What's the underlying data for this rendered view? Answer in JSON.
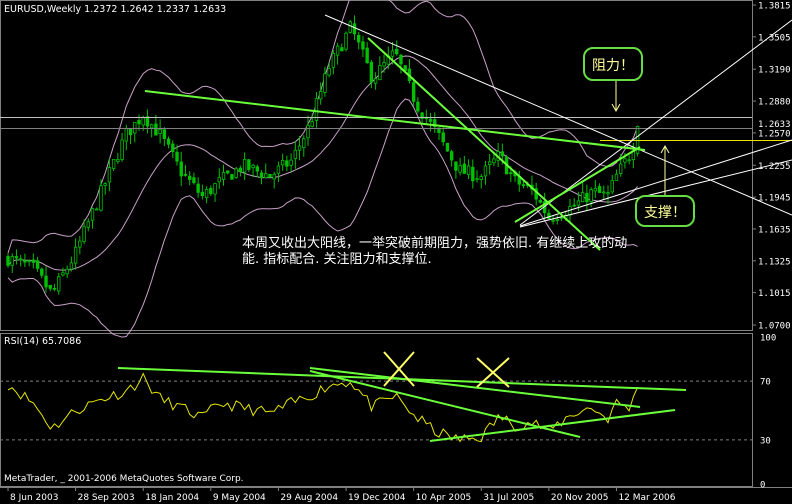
{
  "main_header": "EURUSD,Weekly  1.2372 1.2642 1.2337 1.2633",
  "rsi_header": "RSI(14) 65.7086",
  "copyright": "MetaTrader, _ 2001-2006 MetaQuotes Software Corp.",
  "annotation_line1": "本周又收出大阳线，一举突破前期阻力，强势依旧. 有继续上攻的动",
  "annotation_line2": "能. 指标配合. 关注阻力和支撑位.",
  "resistance_label": "阻力！",
  "support_label": "支撑！",
  "current_price_label": "1.2633",
  "price_ticks": [
    "1.3815",
    "1.3505",
    "1.3190",
    "1.2880",
    "1.2570",
    "1.2255",
    "1.1945",
    "1.1635",
    "1.1325",
    "1.1015",
    "1.0700"
  ],
  "rsi_ticks": [
    "100",
    "70",
    "30",
    "0"
  ],
  "date_ticks": [
    "8 Jun 2003",
    "28 Sep 2003",
    "18 Jan 2004",
    "9 May 2004",
    "29 Aug 2004",
    "19 Dec 2004",
    "10 Apr 2005",
    "31 Jul 2005",
    "20 Nov 2005",
    "12 Mar 2006"
  ],
  "colors": {
    "background": "#000000",
    "candles": "#00c000",
    "bands": "#c8a0c8",
    "trendlines": "#6aff3a",
    "rsi_line": "#e6e600",
    "cross_marks": "#ffff66",
    "callout_border": "#66dd44",
    "callout_text": "#ffff99",
    "grid": "#808080"
  },
  "chart_data": [
    {
      "type": "candlestick",
      "title": "EURUSD,Weekly  1.2372 1.2642 1.2337 1.2633",
      "ylim": [
        1.07,
        1.3815
      ],
      "y_ticks": [
        1.3815,
        1.3505,
        1.319,
        1.288,
        1.257,
        1.2255,
        1.1945,
        1.1635,
        1.1325,
        1.1015,
        1.07
      ],
      "x_ticks": [
        "8 Jun 2003",
        "28 Sep 2003",
        "18 Jan 2004",
        "9 May 2004",
        "29 Aug 2004",
        "19 Dec 2004",
        "10 Apr 2005",
        "31 Jul 2005",
        "20 Nov 2005",
        "12 Mar 2006"
      ],
      "last_price": 1.2633,
      "close_path": [
        {
          "date": "2003-06-08",
          "close": 1.135
        },
        {
          "date": "2003-07-20",
          "close": 1.125
        },
        {
          "date": "2003-08-20",
          "close": 1.1
        },
        {
          "date": "2003-09-28",
          "close": 1.14
        },
        {
          "date": "2003-11-10",
          "close": 1.2
        },
        {
          "date": "2003-12-20",
          "close": 1.255
        },
        {
          "date": "2004-01-18",
          "close": 1.275
        },
        {
          "date": "2004-02-15",
          "close": 1.255
        },
        {
          "date": "2004-03-20",
          "close": 1.22
        },
        {
          "date": "2004-04-25",
          "close": 1.195
        },
        {
          "date": "2004-05-25",
          "close": 1.21
        },
        {
          "date": "2004-07-01",
          "close": 1.225
        },
        {
          "date": "2004-08-15",
          "close": 1.215
        },
        {
          "date": "2004-09-20",
          "close": 1.23
        },
        {
          "date": "2004-10-20",
          "close": 1.265
        },
        {
          "date": "2004-11-20",
          "close": 1.32
        },
        {
          "date": "2004-12-27",
          "close": 1.36
        },
        {
          "date": "2005-02-01",
          "close": 1.31
        },
        {
          "date": "2005-03-10",
          "close": 1.335
        },
        {
          "date": "2005-04-15",
          "close": 1.285
        },
        {
          "date": "2005-05-20",
          "close": 1.255
        },
        {
          "date": "2005-06-25",
          "close": 1.22
        },
        {
          "date": "2005-07-31",
          "close": 1.215
        },
        {
          "date": "2005-08-30",
          "close": 1.235
        },
        {
          "date": "2005-09-25",
          "close": 1.21
        },
        {
          "date": "2005-10-25",
          "close": 1.2
        },
        {
          "date": "2005-11-20",
          "close": 1.175
        },
        {
          "date": "2005-12-30",
          "close": 1.185
        },
        {
          "date": "2006-02-01",
          "close": 1.2
        },
        {
          "date": "2006-02-25",
          "close": 1.195
        },
        {
          "date": "2006-03-12",
          "close": 1.215
        },
        {
          "date": "2006-04-02",
          "close": 1.235
        },
        {
          "date": "2006-04-20",
          "close": 1.2633
        }
      ]
    },
    {
      "type": "line",
      "title": "RSI(14) 65.7086",
      "ylim": [
        0,
        100
      ],
      "y_ticks": [
        100,
        70,
        30,
        0
      ],
      "levels": [
        70,
        30
      ],
      "last_value": 65.7086,
      "x": [
        "2003-06-08",
        "2003-07-20",
        "2003-08-20",
        "2003-09-28",
        "2003-11-10",
        "2003-12-20",
        "2004-01-18",
        "2004-02-15",
        "2004-03-20",
        "2004-04-25",
        "2004-05-25",
        "2004-07-01",
        "2004-08-15",
        "2004-09-20",
        "2004-10-20",
        "2004-11-20",
        "2004-12-27",
        "2005-02-01",
        "2005-03-10",
        "2005-04-15",
        "2005-05-20",
        "2005-06-25",
        "2005-07-31",
        "2005-08-30",
        "2005-09-25",
        "2005-10-25",
        "2005-11-20",
        "2005-12-30",
        "2006-02-01",
        "2006-02-25",
        "2006-03-12",
        "2006-04-02",
        "2006-04-20"
      ],
      "values": [
        68,
        55,
        38,
        50,
        58,
        63,
        72,
        58,
        52,
        45,
        55,
        52,
        48,
        55,
        60,
        67,
        70,
        52,
        60,
        45,
        35,
        30,
        32,
        46,
        40,
        42,
        36,
        48,
        52,
        44,
        55,
        52,
        65.7
      ]
    }
  ]
}
